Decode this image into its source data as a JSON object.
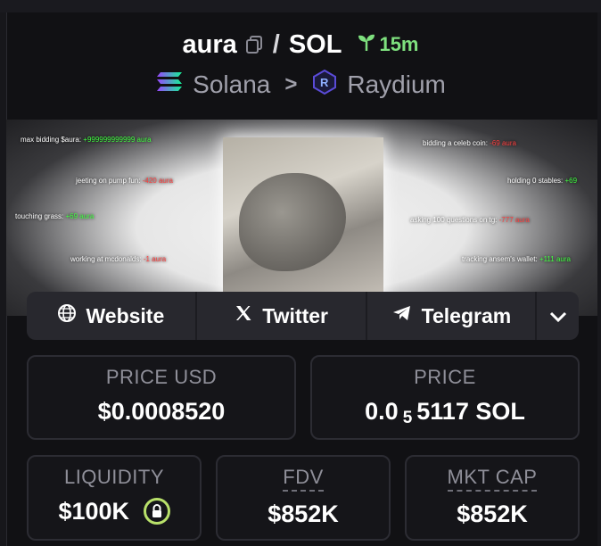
{
  "header": {
    "token_symbol": "aura",
    "separator": "/",
    "quote_symbol": "SOL",
    "age": "15m",
    "chain": "Solana",
    "chevron": ">",
    "dex": "Raydium"
  },
  "banner": {
    "labels": [
      {
        "text": "max bidding $aura: ",
        "value": "+999999999999 aura",
        "color": "g"
      },
      {
        "text": "jeeting on pump fun: ",
        "value": "-420 aura",
        "color": "r"
      },
      {
        "text": "touching grass: ",
        "value": "+69 aura",
        "color": "g"
      },
      {
        "text": "working at mcdonalds: ",
        "value": "-1 aura",
        "color": "r"
      },
      {
        "text": "bidding a celeb coin: ",
        "value": "-69 aura",
        "color": "r"
      },
      {
        "text": "holding 0 stables: ",
        "value": "+69",
        "color": "g"
      },
      {
        "text": "asking 100 questions on tg: ",
        "value": "-777 aura",
        "color": "r"
      },
      {
        "text": "tracking ansem's wallet: ",
        "value": "+111 aura",
        "color": "g"
      }
    ]
  },
  "links": {
    "website": "Website",
    "twitter": "Twitter",
    "telegram": "Telegram"
  },
  "stats": {
    "price_usd_label": "PRICE USD",
    "price_usd_value": "$0.0008520",
    "price_label": "PRICE",
    "price_prefix": "0.0",
    "price_zeros": "5",
    "price_suffix": "5117 SOL",
    "liquidity_label": "LIQUIDITY",
    "liquidity_value": "$100K",
    "fdv_label": "FDV",
    "fdv_value": "$852K",
    "mktcap_label": "MKT CAP",
    "mktcap_value": "$852K"
  },
  "colors": {
    "age_green": "#7ee07e",
    "lock_green": "#b8e06a",
    "background": "#111114",
    "card_border": "#2c2c33"
  },
  "icons": [
    "copy-icon",
    "sprout-icon",
    "solana-logo-icon",
    "chevron-right-icon",
    "raydium-logo-icon",
    "globe-icon",
    "x-logo-icon",
    "telegram-icon",
    "chevron-down-icon",
    "lock-icon"
  ]
}
